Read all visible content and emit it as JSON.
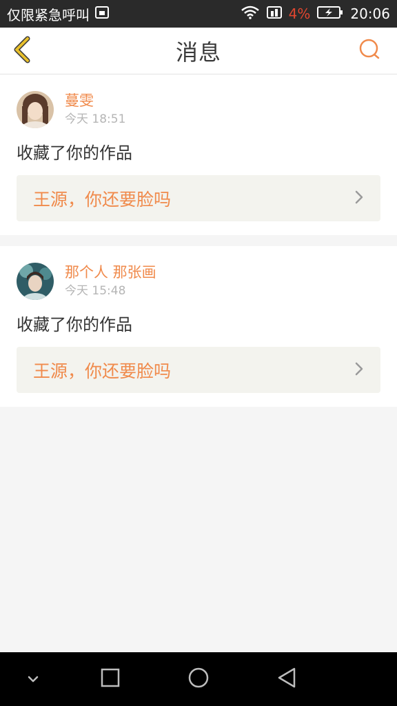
{
  "status_bar": {
    "carrier_text": "仅限紧急呼叫",
    "battery_percent": "4%",
    "time": "20:06",
    "icons": [
      "sim-card-icon",
      "wifi-icon",
      "data-icon",
      "battery-charging-icon"
    ]
  },
  "header": {
    "title": "消息",
    "back_icon": "back-chevron-icon",
    "action_icon": "search-icon"
  },
  "messages": [
    {
      "user": "蔓雯",
      "time": "今天 18:51",
      "action": "收藏了你的作品",
      "work_title": "王源，你还要脸吗",
      "avatar_color": "#c9a98c"
    },
    {
      "user": "那个人 那张画",
      "time": "今天 15:48",
      "action": "收藏了你的作品",
      "work_title": "王源，你还要脸吗",
      "avatar_color": "#3b6f7a"
    }
  ],
  "system_nav": {
    "icons": [
      "hide-keyboard-icon",
      "recent-apps-icon",
      "home-icon",
      "back-icon"
    ]
  },
  "colors": {
    "accent": "#f08a4b",
    "back_icon": "#e8c02c",
    "battery_low": "#e0462f"
  }
}
